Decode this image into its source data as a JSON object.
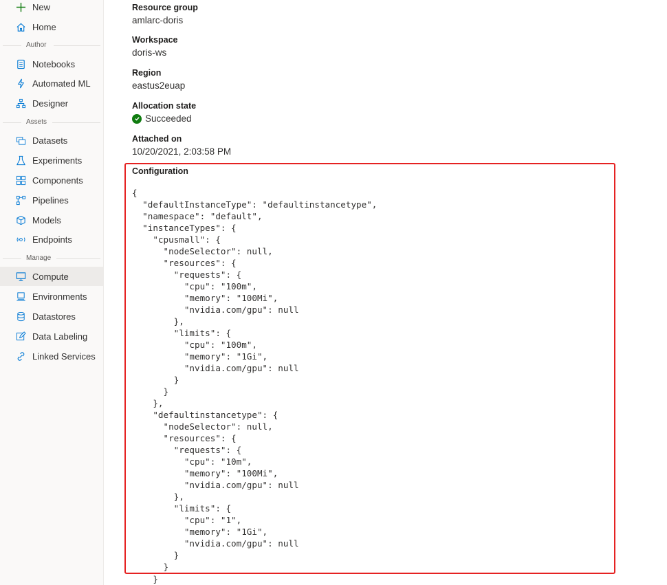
{
  "sidebar": {
    "new_label": "New",
    "home_label": "Home",
    "sections": {
      "author": "Author",
      "assets": "Assets",
      "manage": "Manage"
    },
    "items": {
      "notebooks": "Notebooks",
      "automated_ml": "Automated ML",
      "designer": "Designer",
      "datasets": "Datasets",
      "experiments": "Experiments",
      "components": "Components",
      "pipelines": "Pipelines",
      "models": "Models",
      "endpoints": "Endpoints",
      "compute": "Compute",
      "environments": "Environments",
      "datastores": "Datastores",
      "data_labeling": "Data Labeling",
      "linked_services": "Linked Services"
    },
    "selected": "compute",
    "icons": {
      "new": "plus-icon",
      "home": "home-icon",
      "notebooks": "notebook-icon",
      "automated_ml": "lightning-icon",
      "designer": "hierarchy-icon",
      "datasets": "dataset-icon",
      "experiments": "flask-icon",
      "components": "grid-icon",
      "pipelines": "pipeline-icon",
      "models": "cube-icon",
      "endpoints": "endpoint-icon",
      "compute": "monitor-icon",
      "environments": "environment-icon",
      "datastores": "database-icon",
      "data_labeling": "edit-icon",
      "linked_services": "link-icon"
    }
  },
  "details": {
    "resource_group_label": "Resource group",
    "resource_group_value": "amlarc-doris",
    "workspace_label": "Workspace",
    "workspace_value": "doris-ws",
    "region_label": "Region",
    "region_value": "eastus2euap",
    "allocation_state_label": "Allocation state",
    "allocation_state_value": "Succeeded",
    "attached_on_label": "Attached on",
    "attached_on_value": "10/20/2021, 2:03:58 PM",
    "configuration_label": "Configuration",
    "configuration_json": "{\n  \"defaultInstanceType\": \"defaultinstancetype\",\n  \"namespace\": \"default\",\n  \"instanceTypes\": {\n    \"cpusmall\": {\n      \"nodeSelector\": null,\n      \"resources\": {\n        \"requests\": {\n          \"cpu\": \"100m\",\n          \"memory\": \"100Mi\",\n          \"nvidia.com/gpu\": null\n        },\n        \"limits\": {\n          \"cpu\": \"100m\",\n          \"memory\": \"1Gi\",\n          \"nvidia.com/gpu\": null\n        }\n      }\n    },\n    \"defaultinstancetype\": {\n      \"nodeSelector\": null,\n      \"resources\": {\n        \"requests\": {\n          \"cpu\": \"10m\",\n          \"memory\": \"100Mi\",\n          \"nvidia.com/gpu\": null\n        },\n        \"limits\": {\n          \"cpu\": \"1\",\n          \"memory\": \"1Gi\",\n          \"nvidia.com/gpu\": null\n        }\n      }",
    "configuration_tail": "    }",
    "colors": {
      "highlight_border": "#e52222",
      "success": "#107c10",
      "accent": "#0078d4"
    }
  }
}
